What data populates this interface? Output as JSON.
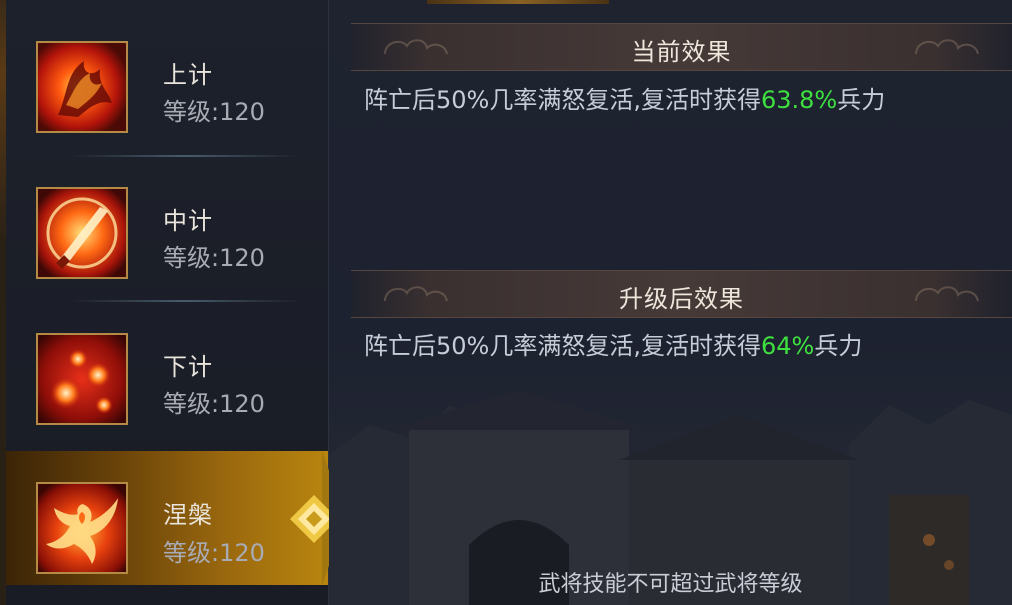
{
  "skills": [
    {
      "name": "上计",
      "level": "等级:120",
      "icon": "fire-blade-icon"
    },
    {
      "name": "中计",
      "level": "等级:120",
      "icon": "fire-sword-icon"
    },
    {
      "name": "下计",
      "level": "等级:120",
      "icon": "fire-orbs-icon"
    },
    {
      "name": "涅槃",
      "level": "等级:120",
      "icon": "phoenix-icon",
      "selected": true
    }
  ],
  "current": {
    "title": "当前效果",
    "text_before": "阵亡后50%几率满怒复活,复活时获得",
    "value": "63.8%",
    "text_after": "兵力"
  },
  "next": {
    "title": "升级后效果",
    "text_before": "阵亡后50%几率满怒复活,复活时获得",
    "value": "64%",
    "text_after": "兵力"
  },
  "footer": "武将技能不可超过武将等级",
  "colors": {
    "highlight": "#3ee03f",
    "selected": "#b8850f",
    "frame": "#b48a45"
  }
}
